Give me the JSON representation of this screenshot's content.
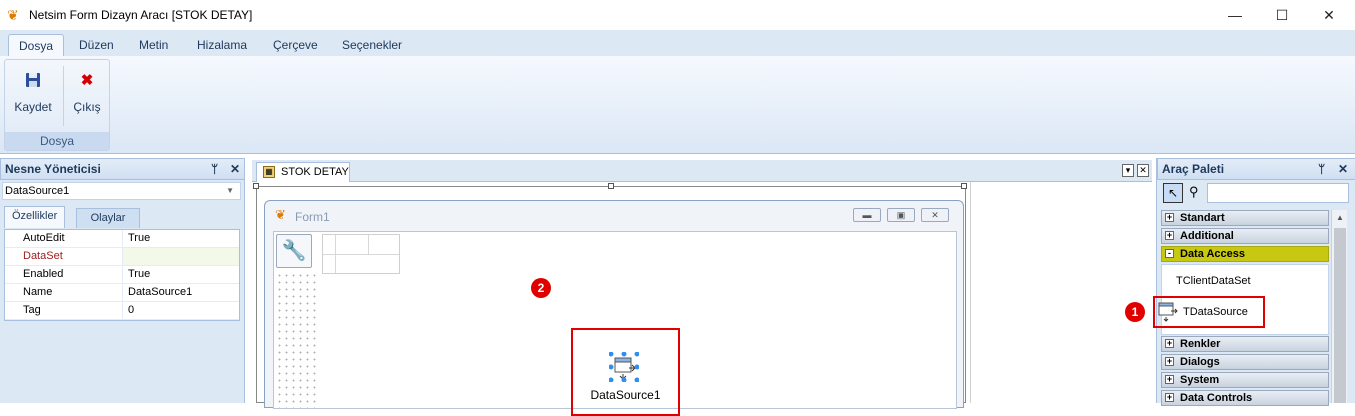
{
  "window": {
    "title": "Netsim Form Dizayn Aracı [STOK DETAY]"
  },
  "ribbon": {
    "tabs": [
      "Dosya",
      "Düzen",
      "Metin",
      "Hizalama",
      "Çerçeve",
      "Seçenekler"
    ],
    "active_tab": "Dosya",
    "group_label": "Dosya",
    "buttons": [
      {
        "label": "Kaydet",
        "icon": "save-icon"
      },
      {
        "label": "Çıkış",
        "icon": "exit-icon"
      }
    ]
  },
  "object_inspector": {
    "title": "Nesne Yöneticisi",
    "selected_object": "DataSource1",
    "tabs": [
      "Özellikler",
      "Olaylar"
    ],
    "properties": [
      {
        "name": "AutoEdit",
        "value": "True"
      },
      {
        "name": "DataSet",
        "value": ""
      },
      {
        "name": "Enabled",
        "value": "True"
      },
      {
        "name": "Name",
        "value": "DataSource1"
      },
      {
        "name": "Tag",
        "value": "0"
      }
    ]
  },
  "designer": {
    "doc_tab": "STOK DETAY",
    "form_title": "Form1",
    "component_label": "DataSource1",
    "badge_2": "2"
  },
  "palette": {
    "title": "Araç Paleti",
    "categories": [
      {
        "label": "Standart",
        "toggle": "+"
      },
      {
        "label": "Additional",
        "toggle": "+"
      },
      {
        "label": "Data Access",
        "toggle": "-"
      },
      {
        "label": "Renkler",
        "toggle": "+"
      },
      {
        "label": "Dialogs",
        "toggle": "+"
      },
      {
        "label": "System",
        "toggle": "+"
      },
      {
        "label": "Data Controls",
        "toggle": "+"
      }
    ],
    "items": [
      "TClientDataSet",
      "TDataSource"
    ],
    "badge_1": "1"
  },
  "colors": {
    "highlight": "#c8c813",
    "marker_red": "#e00000",
    "accent": "#1e395b"
  }
}
